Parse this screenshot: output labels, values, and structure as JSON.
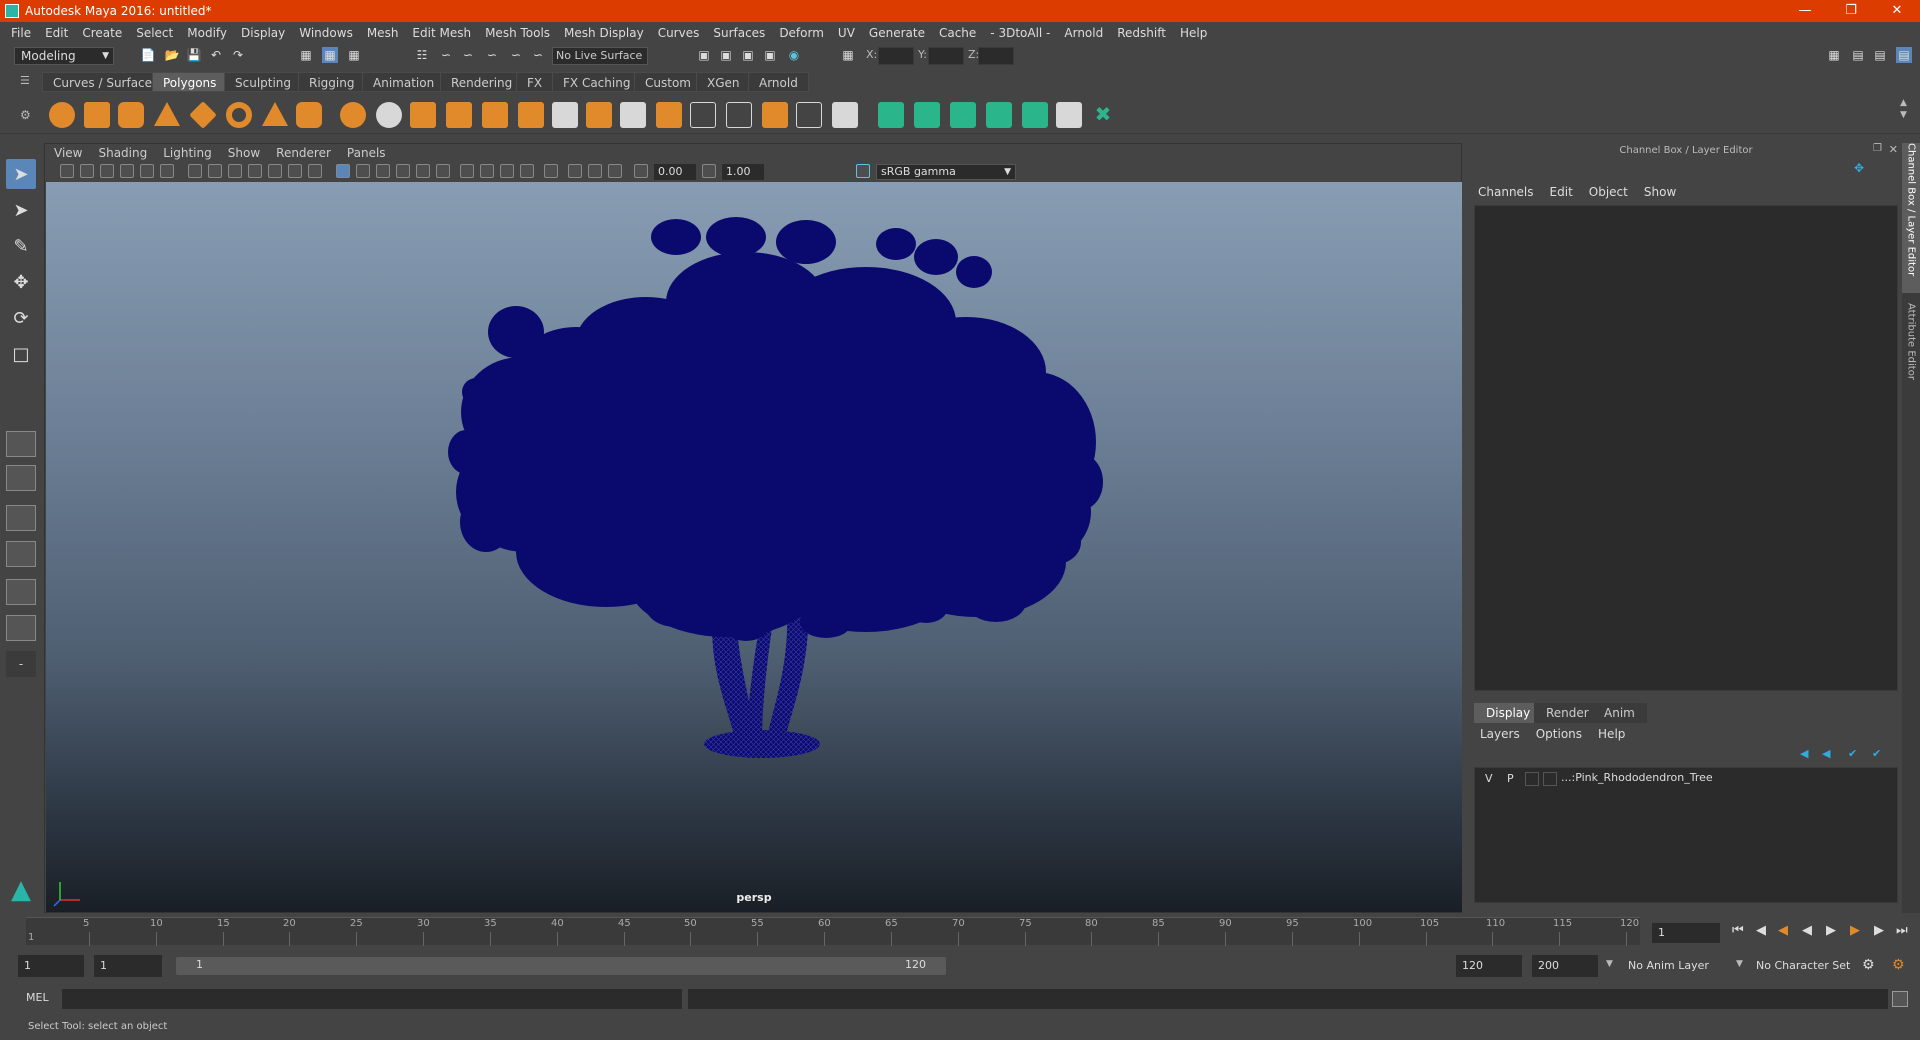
{
  "window": {
    "title": "Autodesk Maya 2016: untitled*"
  },
  "menubar": [
    "File",
    "Edit",
    "Create",
    "Select",
    "Modify",
    "Display",
    "Windows",
    "Mesh",
    "Edit Mesh",
    "Mesh Tools",
    "Mesh Display",
    "Curves",
    "Surfaces",
    "Deform",
    "UV",
    "Generate",
    "Cache",
    "- 3DtoAll -",
    "Arnold",
    "Redshift",
    "Help"
  ],
  "statusline": {
    "mode": "Modeling",
    "live_surface": "No Live Surface",
    "x_label": "X:",
    "y_label": "Y:",
    "z_label": "Z:"
  },
  "shelf": {
    "tabs": [
      "Curves / Surfaces",
      "Polygons",
      "Sculpting",
      "Rigging",
      "Animation",
      "Rendering",
      "FX",
      "FX Caching",
      "Custom",
      "XGen",
      "Arnold"
    ],
    "active_tab": "Polygons"
  },
  "viewport": {
    "menu": [
      "View",
      "Shading",
      "Lighting",
      "Show",
      "Renderer",
      "Panels"
    ],
    "exposure": "0.00",
    "gamma_value": "1.00",
    "color_space": "sRGB gamma",
    "camera_label": "persp"
  },
  "right_panel": {
    "title": "Channel Box / Layer Editor",
    "channel_menu": [
      "Channels",
      "Edit",
      "Object",
      "Show"
    ],
    "layer_tabs": [
      "Display",
      "Render",
      "Anim"
    ],
    "layer_menu": [
      "Layers",
      "Options",
      "Help"
    ],
    "layer": {
      "v": "V",
      "p": "P",
      "name": "...:Pink_Rhododendron_Tree"
    },
    "side_tabs": [
      "Channel Box / Layer Editor",
      "Attribute Editor"
    ]
  },
  "timeline": {
    "ticks": [
      "5",
      "10",
      "15",
      "20",
      "25",
      "30",
      "35",
      "40",
      "45",
      "50",
      "55",
      "60",
      "65",
      "70",
      "75",
      "80",
      "85",
      "90",
      "95",
      "100",
      "105",
      "110",
      "115",
      "120"
    ],
    "start_tick": "1",
    "current_frame": "1"
  },
  "range": {
    "start": "1",
    "playback_start": "1",
    "slider_start": "1",
    "slider_end": "120",
    "playback_end": "120",
    "end": "200",
    "anim_layer": "No Anim Layer",
    "character_set": "No Character Set"
  },
  "command": {
    "label": "MEL"
  },
  "help_line": "Select Tool: select an object",
  "colors": {
    "title_bar": "#dd3c00",
    "tree": "#0a0a6e",
    "accent": "#5b87b8"
  }
}
